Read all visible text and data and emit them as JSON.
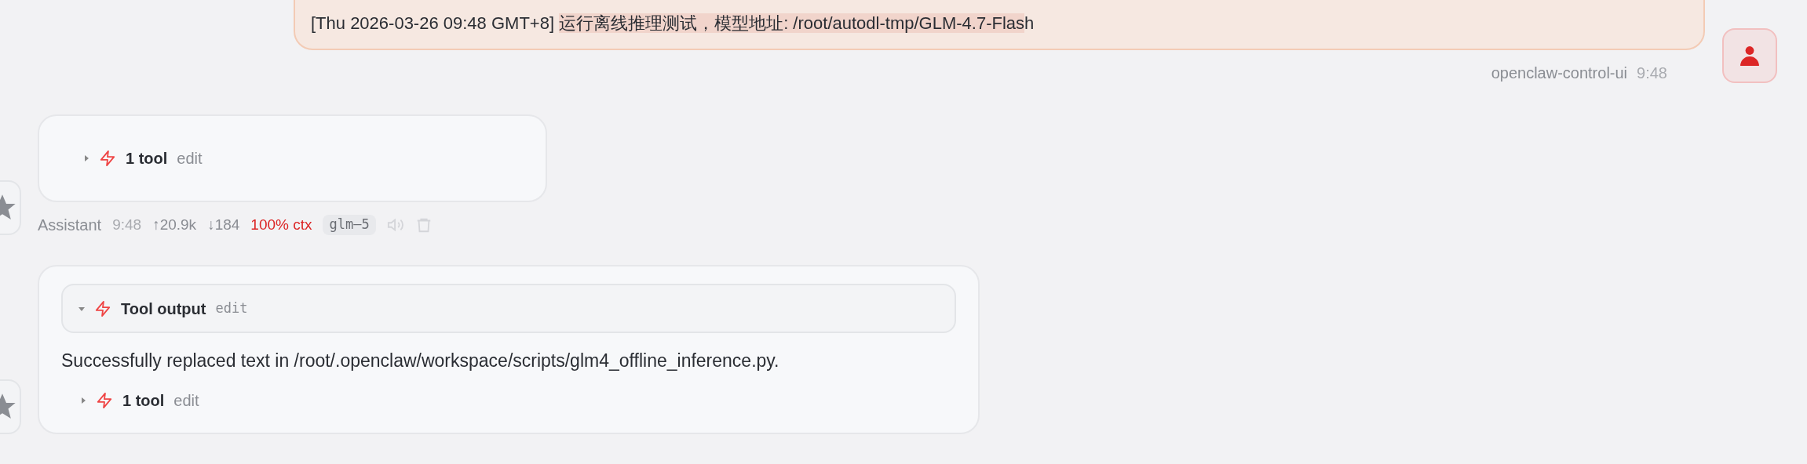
{
  "messages": [
    {
      "kind": "user",
      "segments": [
        {
          "text": "[Thu 2026-03-26 09:48 GMT+8] ",
          "highlighted": false
        },
        {
          "text": "运行离线推理测试，模型地址: /root/autodl-tmp/GLM-4.7-Flas",
          "highlighted": true
        },
        {
          "text": "h",
          "highlighted": false
        }
      ],
      "sender": "openclaw-control-ui",
      "time": "9:48"
    },
    {
      "kind": "assistant",
      "blocks": [
        {
          "kind": "tool_summary",
          "expanded": false,
          "label": "1 tool",
          "name": "edit"
        }
      ],
      "meta": {
        "sender": "Assistant",
        "time": "9:48",
        "tokens_in": "↑20.9k",
        "tokens_out": "↓184",
        "context": "100% ctx",
        "model": "glm–5"
      }
    },
    {
      "kind": "assistant",
      "blocks": [
        {
          "kind": "tool_output",
          "expanded": true,
          "label": "Tool output",
          "name": "edit"
        },
        {
          "kind": "text",
          "text": "Successfully replaced text in /root/.openclaw/workspace/scripts/glm4_offline_inference.py."
        },
        {
          "kind": "tool_summary",
          "expanded": false,
          "label": "1 tool",
          "name": "edit"
        }
      ]
    }
  ]
}
